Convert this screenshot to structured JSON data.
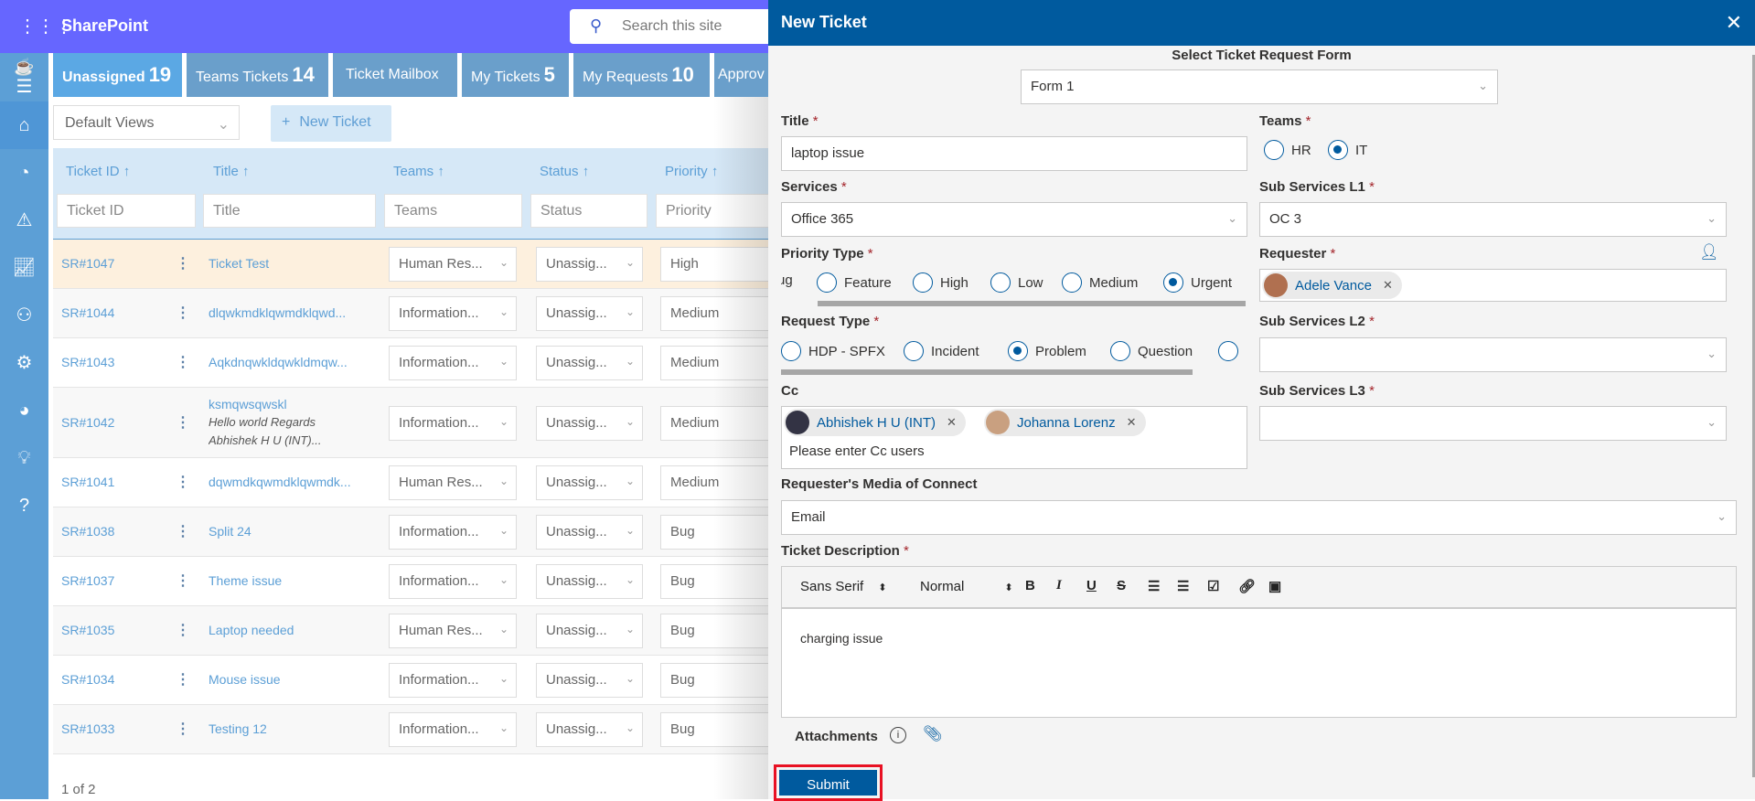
{
  "app": {
    "name": "SharePoint",
    "search_placeholder": "Search this site"
  },
  "tabs": [
    {
      "label": "Unassigned",
      "count": "19"
    },
    {
      "label": "Teams Tickets",
      "count": "14"
    },
    {
      "label": "Ticket Mailbox",
      "count": ""
    },
    {
      "label": "My Tickets",
      "count": "5"
    },
    {
      "label": "My Requests",
      "count": "10"
    },
    {
      "label": "Approv",
      "count": ""
    }
  ],
  "toolbar": {
    "views": "Default Views",
    "new_ticket": "New Ticket"
  },
  "table": {
    "columns": [
      "Ticket ID ↑",
      "Title ↑",
      "Teams ↑",
      "Status ↑",
      "Priority ↑"
    ],
    "filters": [
      "Ticket ID",
      "Title",
      "Teams",
      "Status",
      "Priority"
    ],
    "rows": [
      {
        "id": "SR#1047",
        "title": "Ticket Test",
        "team": "Human Res...",
        "status": "Unassig...",
        "priority": "High"
      },
      {
        "id": "SR#1044",
        "title": "dlqwkmdklqwmdklqwd...",
        "team": "Information...",
        "status": "Unassig...",
        "priority": "Medium"
      },
      {
        "id": "SR#1043",
        "title": "Aqkdnqwkldqwkldmqw...",
        "team": "Information...",
        "status": "Unassig...",
        "priority": "Medium"
      },
      {
        "id": "SR#1042",
        "title": "ksmqwsqwskl",
        "sub1": "Hello world Regards",
        "sub2": "Abhishek H U (INT)...",
        "team": "Information...",
        "status": "Unassig...",
        "priority": "Medium"
      },
      {
        "id": "SR#1041",
        "title": "dqwmdkqwmdklqwmdk...",
        "team": "Human Res...",
        "status": "Unassig...",
        "priority": "Medium"
      },
      {
        "id": "SR#1038",
        "title": "Split 24",
        "team": "Information...",
        "status": "Unassig...",
        "priority": "Bug"
      },
      {
        "id": "SR#1037",
        "title": "Theme issue",
        "team": "Information...",
        "status": "Unassig...",
        "priority": "Bug"
      },
      {
        "id": "SR#1035",
        "title": "Laptop needed",
        "team": "Human Res...",
        "status": "Unassig...",
        "priority": "Bug"
      },
      {
        "id": "SR#1034",
        "title": "Mouse issue",
        "team": "Information...",
        "status": "Unassig...",
        "priority": "Bug"
      },
      {
        "id": "SR#1033",
        "title": "Testing 12",
        "team": "Information...",
        "status": "Unassig...",
        "priority": "Bug"
      }
    ],
    "pager": "1 of 2"
  },
  "panel": {
    "title": "New Ticket",
    "form_label": "Select Ticket Request Form",
    "form_value": "Form 1",
    "title_label": "Title",
    "title_value": "laptop issue",
    "teams_label": "Teams",
    "teams_options": [
      "HR",
      "IT"
    ],
    "teams_selected": "IT",
    "services_label": "Services",
    "services_value": "Office 365",
    "sub1_label": "Sub Services L1",
    "sub1_value": "OC 3",
    "priority_label": "Priority Type",
    "priority_options": [
      "Bug",
      "Feature",
      "High",
      "Low",
      "Medium",
      "Urgent"
    ],
    "priority_selected": "Urgent",
    "requester_label": "Requester",
    "requester": "Adele Vance",
    "request_type_label": "Request Type",
    "request_type_options": [
      "HDP - SPFX",
      "Incident",
      "Problem",
      "Question"
    ],
    "request_type_selected": "Problem",
    "sub2_label": "Sub Services L2",
    "sub2_value": "",
    "cc_label": "Cc",
    "cc_users": [
      "Abhishek H U (INT)",
      "Johanna Lorenz"
    ],
    "cc_placeholder": "Please enter Cc users",
    "sub3_label": "Sub Services L3",
    "sub3_value": "",
    "media_label": "Requester's Media of Connect",
    "media_value": "Email",
    "desc_label": "Ticket Description",
    "font": "Sans Serif",
    "size": "Normal",
    "desc_value": "charging issue",
    "attachments_label": "Attachments",
    "submit": "Submit",
    "required_mark": "*",
    "accent": "#005a9e",
    "highlight": "#e81123"
  }
}
